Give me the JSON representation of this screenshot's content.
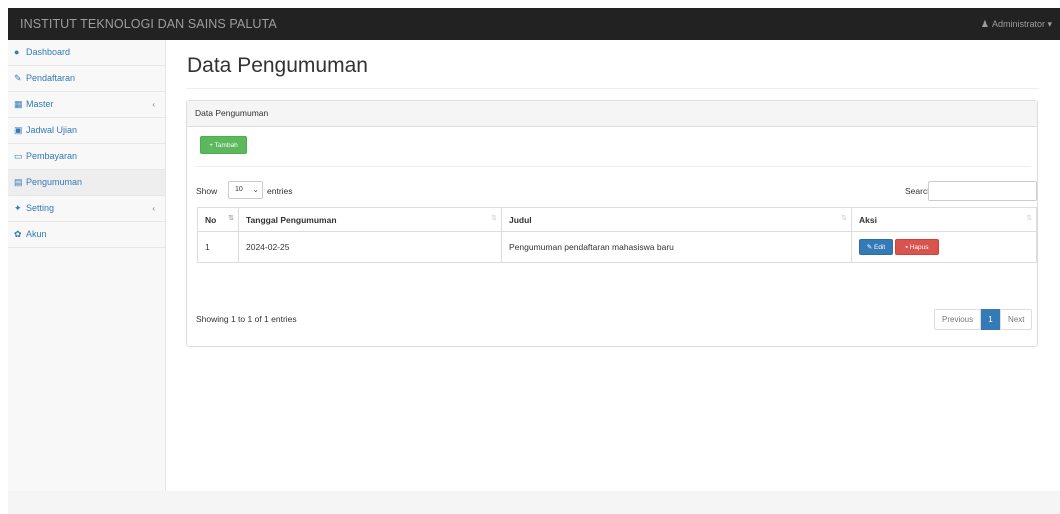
{
  "navbar": {
    "brand": "INSTITUT TEKNOLOGI DAN SAINS PALUTA",
    "user_icon": "user-icon",
    "user": "Administrator",
    "caret": "▾"
  },
  "sidebar": {
    "items": [
      {
        "icon": "dashboard-icon",
        "glyph": "●",
        "label": "Dashboard",
        "caret": "",
        "active": false
      },
      {
        "icon": "pencil-icon",
        "glyph": "✎",
        "label": "Pendaftaran",
        "caret": "",
        "active": false
      },
      {
        "icon": "table-icon",
        "glyph": "▦",
        "label": "Master",
        "caret": "‹",
        "active": false
      },
      {
        "icon": "calendar-icon",
        "glyph": "▣",
        "label": "Jadwal Ujian",
        "caret": "",
        "active": false
      },
      {
        "icon": "money-icon",
        "glyph": "▭",
        "label": "Pembayaran",
        "caret": "",
        "active": false
      },
      {
        "icon": "file-icon",
        "glyph": "▤",
        "label": "Pengumuman",
        "caret": "",
        "active": true
      },
      {
        "icon": "wrench-icon",
        "glyph": "✦",
        "label": "Setting",
        "caret": "‹",
        "active": false
      },
      {
        "icon": "gear-icon",
        "glyph": "✿",
        "label": "Akun",
        "caret": "",
        "active": false
      }
    ]
  },
  "main": {
    "title": "Data Pengumuman",
    "panel_title": "Data Pengumuman",
    "add_button": "+ Tambah",
    "show_label": "Show",
    "page_length": "10",
    "entries_label": "entries",
    "search_label": "Search:",
    "search_value": "",
    "table": {
      "headers": [
        "No",
        "Tanggal Pengumuman",
        "Judul",
        "Aksi"
      ],
      "rows": [
        {
          "no": "1",
          "tanggal": "2024-02-25",
          "judul": "Pengumuman pendaftaran mahasiswa baru",
          "edit": "✎ Edit",
          "hapus": "▪ Hapus"
        }
      ]
    },
    "info": "Showing 1 to 1 of 1 entries",
    "pagination": {
      "previous": "Previous",
      "current": "1",
      "next": "Next"
    }
  },
  "colors": {
    "navbar": "#222222",
    "link": "#337ab7",
    "success": "#5cb85c",
    "danger": "#d9534f"
  }
}
